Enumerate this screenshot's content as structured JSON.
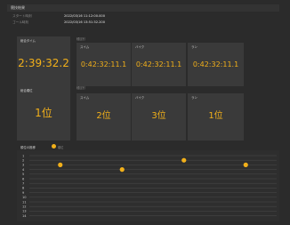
{
  "header": {
    "title": "競技結果"
  },
  "meta": {
    "start_label": "スタート時刻",
    "start_value": "2022/03/16 11:12:00.000",
    "goal_label": "ゴール時刻",
    "goal_value": "2022/03/16 13:51:32.200"
  },
  "total_time": {
    "label": "総合タイム",
    "value": "2:39:32.2"
  },
  "split_section_label": "種目別",
  "splits": [
    {
      "label": "スイム",
      "value": "0:42:32:11.1"
    },
    {
      "label": "バイク",
      "value": "0:42:32:11.1"
    },
    {
      "label": "ラン",
      "value": "0:42:32:11.1"
    }
  ],
  "total_rank": {
    "label": "総合順位",
    "value": "1位"
  },
  "rank_section_label": "種目別",
  "ranks": [
    {
      "label": "スイム",
      "value": "2位"
    },
    {
      "label": "バイク",
      "value": "3位"
    },
    {
      "label": "ラン",
      "value": "1位"
    }
  ],
  "chart_data": {
    "type": "scatter",
    "title": "順位の推移",
    "legend": [
      "順位"
    ],
    "y_ticks": [
      "1",
      "2",
      "3",
      "4",
      "5",
      "6",
      "7",
      "8",
      "9",
      "10",
      "11",
      "12",
      "13",
      "14"
    ],
    "points": [
      {
        "x": 1,
        "y": 3
      },
      {
        "x": 2,
        "y": 4
      },
      {
        "x": 3,
        "y": 2
      },
      {
        "x": 4,
        "y": 3
      }
    ],
    "xlim": [
      0.5,
      4.5
    ],
    "ylim": [
      1,
      14
    ],
    "color": "#f2b01a"
  }
}
